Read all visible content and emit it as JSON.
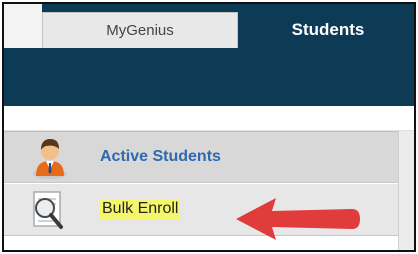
{
  "tabs": {
    "mygenius": "MyGenius",
    "students": "Students"
  },
  "menu": {
    "items": [
      {
        "label": "Active Students",
        "icon": "person-icon"
      },
      {
        "label": "Bulk Enroll",
        "icon": "magnifier-document-icon"
      }
    ]
  },
  "colors": {
    "nav": "#0d3a55",
    "link": "#2d6ab0",
    "highlight": "#f6f66a",
    "arrow": "#e03c3c"
  }
}
